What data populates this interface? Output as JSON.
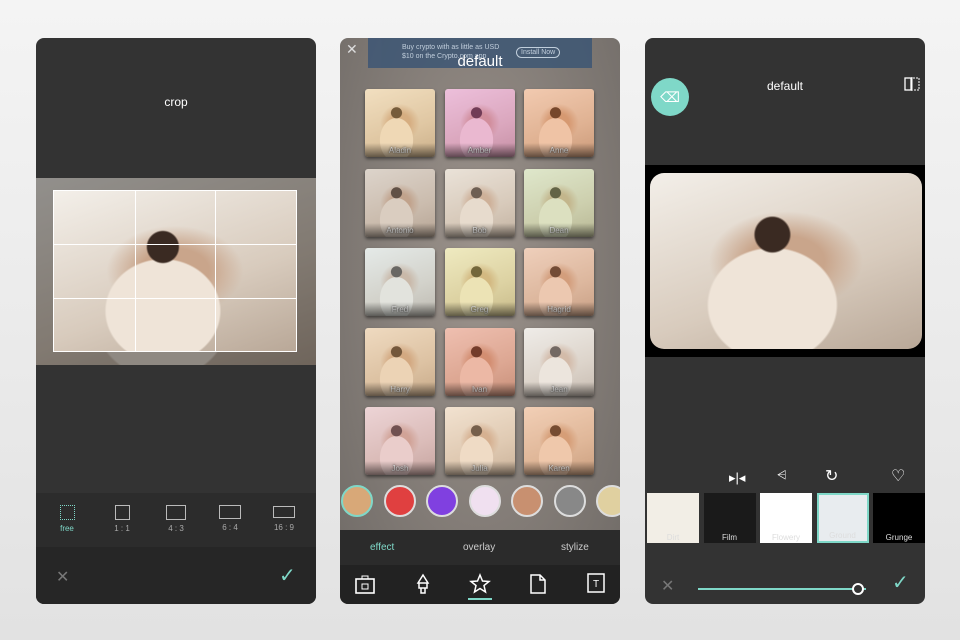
{
  "crop_screen": {
    "title": "crop",
    "ratios": [
      {
        "label": "free",
        "active": true
      },
      {
        "label": "1 : 1"
      },
      {
        "label": "4 : 3"
      },
      {
        "label": "6 : 4"
      },
      {
        "label": "16 : 9"
      }
    ]
  },
  "effect_screen": {
    "title": "default",
    "ad": {
      "text": "Buy crypto with as little as USD $10 on the Crypto.com app",
      "button": "Install Now",
      "brand": "crypto.com"
    },
    "filters": [
      "Aladin",
      "Amber",
      "Anne",
      "Antonio",
      "Bob",
      "Dean",
      "Fred",
      "Greg",
      "Hagrid",
      "Harry",
      "Ivan",
      "Jean",
      "Josh",
      "Julia",
      "Karen"
    ],
    "tabs": [
      {
        "label": "effect",
        "active": true
      },
      {
        "label": "overlay"
      },
      {
        "label": "stylize"
      }
    ],
    "tools": [
      "toolbox-icon",
      "brush-icon",
      "effects-star-icon",
      "sticker-icon",
      "text-icon"
    ]
  },
  "frame_screen": {
    "title": "default",
    "frames": [
      {
        "label": "Dirt"
      },
      {
        "label": "Film"
      },
      {
        "label": "Flowery"
      },
      {
        "label": "Ground",
        "active": true
      },
      {
        "label": "Grunge"
      }
    ],
    "slider_value": 0.95
  },
  "colors": {
    "accent": "#7fd8c8",
    "panel": "#333333"
  }
}
